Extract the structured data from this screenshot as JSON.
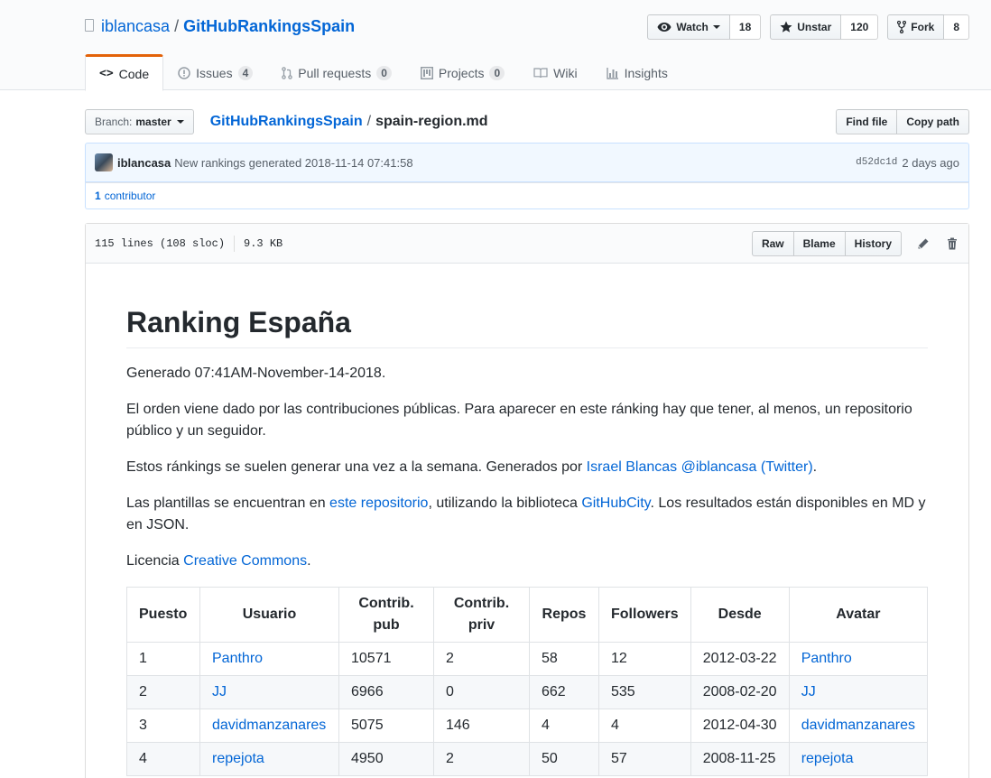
{
  "header": {
    "owner": "iblancasa",
    "separator": "/",
    "repo": "GitHubRankingsSpain",
    "watch": {
      "label": "Watch",
      "count": "18"
    },
    "star": {
      "label": "Unstar",
      "count": "120"
    },
    "fork": {
      "label": "Fork",
      "count": "8"
    }
  },
  "nav": {
    "tabs": [
      {
        "label": "Code",
        "icon": "code-icon"
      },
      {
        "label": "Issues",
        "count": "4",
        "icon": "issue-opened-icon"
      },
      {
        "label": "Pull requests",
        "count": "0",
        "icon": "git-pull-request-icon"
      },
      {
        "label": "Projects",
        "count": "0",
        "icon": "project-icon"
      },
      {
        "label": "Wiki",
        "icon": "book-icon"
      },
      {
        "label": "Insights",
        "icon": "graph-icon"
      }
    ]
  },
  "file_nav": {
    "branch_prefix": "Branch:",
    "branch": "master",
    "breadcrumb_root": "GitHubRankingsSpain",
    "breadcrumb_sep": "/",
    "breadcrumb_file": "spain-region.md",
    "find_file": "Find file",
    "copy_path": "Copy path"
  },
  "commit": {
    "author": "iblancasa",
    "message": "New rankings generated 2018-11-14 07:41:58",
    "sha": "d52dc1d",
    "age": "2 days ago",
    "contributor_count": "1",
    "contributor_label": "contributor"
  },
  "file": {
    "lines": "115 lines (108 sloc)",
    "size": "9.3 KB",
    "raw": "Raw",
    "blame": "Blame",
    "history": "History"
  },
  "readme": {
    "title": "Ranking España",
    "generated": "Generado 07:41AM-November-14-2018.",
    "p1": "El orden viene dado por las contribuciones públicas. Para aparecer en este ránking hay que tener, al menos, un repositorio público y un seguidor.",
    "p2_a": "Estos ránkings se suelen generar una vez a la semana. Generados por ",
    "p2_link": "Israel Blancas @iblancasa (Twitter)",
    "p2_b": ".",
    "p3_a": "Las plantillas se encuentran en ",
    "p3_link1": "este repositorio",
    "p3_b": ", utilizando la biblioteca ",
    "p3_link2": "GitHubCity",
    "p3_c": ". Los resultados están disponibles en MD y en JSON.",
    "p4_a": "Licencia ",
    "p4_link": "Creative Commons",
    "p4_b": "."
  },
  "table": {
    "headers": [
      "Puesto",
      "Usuario",
      "Contrib. pub",
      "Contrib. priv",
      "Repos",
      "Followers",
      "Desde",
      "Avatar"
    ],
    "rows": [
      [
        "1",
        "Panthro",
        "10571",
        "2",
        "58",
        "12",
        "2012-03-22",
        "Panthro"
      ],
      [
        "2",
        "JJ",
        "6966",
        "0",
        "662",
        "535",
        "2008-02-20",
        "JJ"
      ],
      [
        "3",
        "davidmanzanares",
        "5075",
        "146",
        "4",
        "4",
        "2012-04-30",
        "davidmanzanares"
      ],
      [
        "4",
        "repejota",
        "4950",
        "2",
        "50",
        "57",
        "2008-11-25",
        "repejota"
      ]
    ]
  },
  "colors": {
    "link": "#0366d6",
    "tab_accent": "#e36209",
    "commit_bg": "#f1f8ff"
  }
}
